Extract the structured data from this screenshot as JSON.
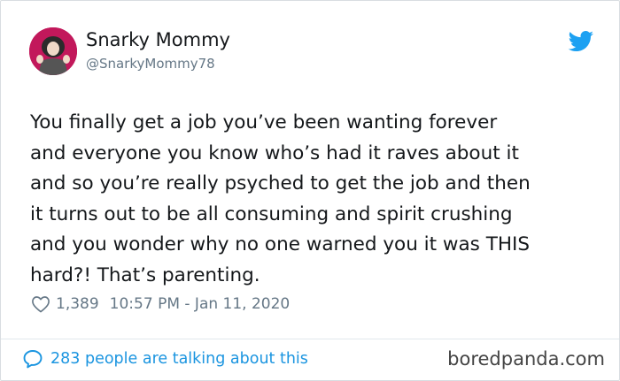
{
  "author": {
    "display_name": "Snarky Mommy",
    "handle": "@SnarkyMommy78",
    "avatar_icon": "profile-photo-avatar",
    "avatar_bg": "#c2185b"
  },
  "tweet": {
    "line1": "You finally get a job you’ve been wanting forever",
    "line2": "and everyone you know who’s had it raves about it",
    "line3": "and so you’re really psyched to get the job and then",
    "line4": "it turns out to be all consuming and spirit crushing",
    "line5": "and you wonder why no one warned you it was THIS",
    "line6": "hard?! That’s parenting."
  },
  "meta": {
    "likes": "1,389",
    "timestamp": "10:57 PM - Jan 11, 2020",
    "heart_icon": "heart-outline-icon"
  },
  "footer": {
    "talking_text": "283 people are talking about this",
    "talking_icon": "speech-bubble-icon",
    "brand": "boredpanda.com",
    "accent_color": "#1b95e0"
  },
  "twitter_icon": "twitter-bird-icon",
  "twitter_color": "#1da1f2"
}
